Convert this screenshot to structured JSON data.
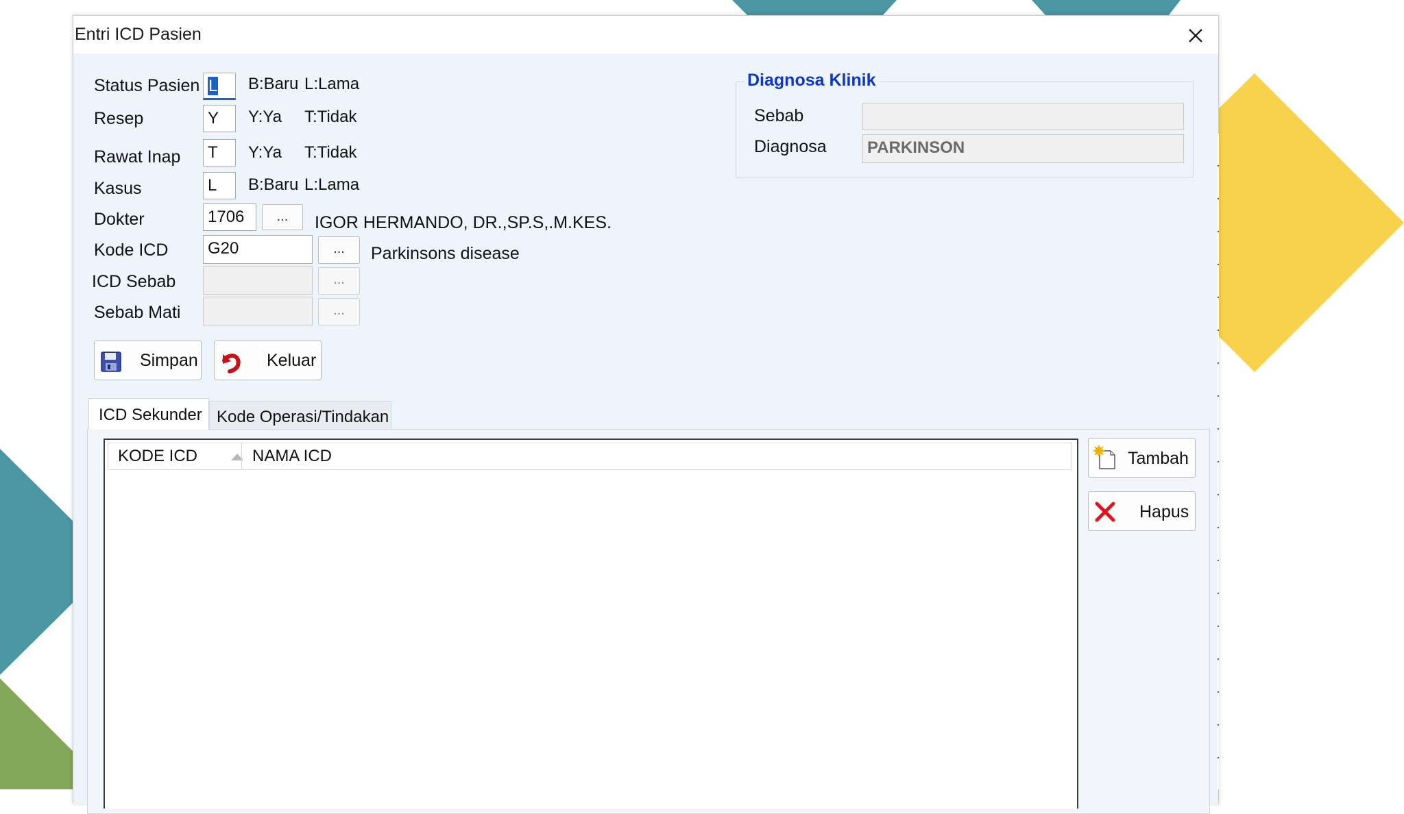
{
  "window": {
    "title": "Entri ICD Pasien"
  },
  "form": {
    "status_pasien": {
      "label": "Status Pasien",
      "value": "L",
      "hint1": "B:Baru",
      "hint2": "L:Lama"
    },
    "resep": {
      "label": "Resep",
      "value": "Y",
      "hint1": "Y:Ya",
      "hint2": "T:Tidak"
    },
    "rawat_inap": {
      "label": "Rawat Inap",
      "value": "T",
      "hint1": "Y:Ya",
      "hint2": "T:Tidak"
    },
    "kasus": {
      "label": "Kasus",
      "value": "L",
      "hint1": "B:Baru",
      "hint2": "L:Lama"
    },
    "dokter": {
      "label": "Dokter",
      "value": "1706",
      "lookup": "...",
      "name": "IGOR HERMANDO, DR.,SP.S,.M.KES."
    },
    "kode_icd": {
      "label": "Kode ICD",
      "value": "G20",
      "lookup": "...",
      "desc": "Parkinsons disease"
    },
    "icd_sebab": {
      "label": "ICD Sebab",
      "value": "",
      "lookup": "..."
    },
    "sebab_mati": {
      "label": "Sebab Mati",
      "value": "",
      "lookup": "..."
    }
  },
  "diagnosa_klinik": {
    "title": "Diagnosa Klinik",
    "sebab_label": "Sebab",
    "sebab_value": "",
    "diagnosa_label": "Diagnosa",
    "diagnosa_value": "PARKINSON"
  },
  "buttons": {
    "simpan": "Simpan",
    "keluar": "Keluar",
    "tambah": "Tambah",
    "hapus": "Hapus"
  },
  "tabs": [
    {
      "label": "ICD Sekunder",
      "active": true
    },
    {
      "label": "Kode Operasi/Tindakan",
      "active": false
    }
  ],
  "grid": {
    "columns": [
      {
        "label": "KODE ICD",
        "sort": "ascending"
      },
      {
        "label": "NAMA ICD"
      }
    ],
    "rows": []
  },
  "colors": {
    "teal": "#4a96a3",
    "yellow": "#f8d24a",
    "green": "#83a958",
    "accent_blue": "#1036c8",
    "focus_blue": "#1a62c4"
  }
}
